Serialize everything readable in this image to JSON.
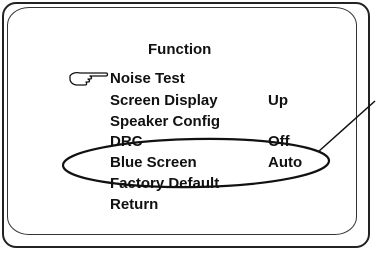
{
  "menu": {
    "title": "Function",
    "items": [
      {
        "label": "Noise Test",
        "value": "",
        "selected": true
      },
      {
        "label": "Screen Display",
        "value": "Up",
        "selected": false
      },
      {
        "label": "Speaker Config",
        "value": "",
        "selected": false
      },
      {
        "label": "DRC",
        "value": "Off",
        "selected": false
      },
      {
        "label": "Blue Screen",
        "value": "Auto",
        "selected": false
      },
      {
        "label": "Factory Default",
        "value": "",
        "selected": false
      },
      {
        "label": "Return",
        "value": "",
        "selected": false
      }
    ]
  },
  "cursor_icon": "pointing-hand-icon",
  "callout": {
    "highlighted_item": "Blue Screen"
  }
}
